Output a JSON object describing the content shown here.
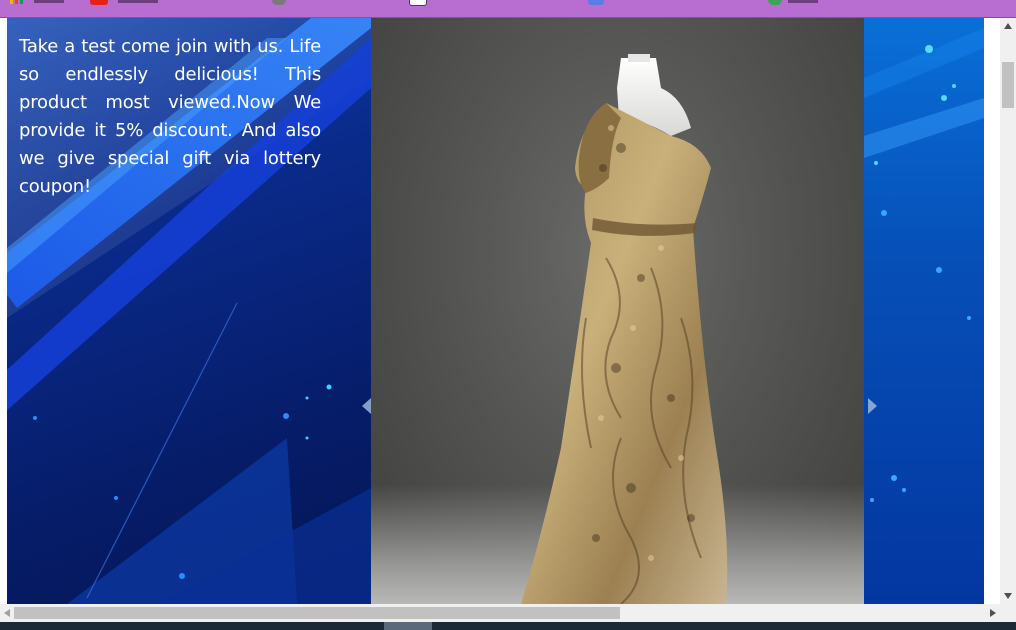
{
  "promo": {
    "text": "Take a test come join with us. Life so endlessly delicious! This product most viewed.Now We provide it 5% discount. And also we give special gift via lottery coupon!"
  },
  "slider": {
    "prev_icon": "chevron-left-icon",
    "next_icon": "chevron-right-icon"
  },
  "photo": {
    "subject": "gold-lace-evening-gown-on-mannequin"
  },
  "colors": {
    "bookmark_bar": "#b76ed0",
    "banner_blue": "#0a2a8a",
    "photo_gray": "#555553",
    "text": "#ffffff"
  }
}
